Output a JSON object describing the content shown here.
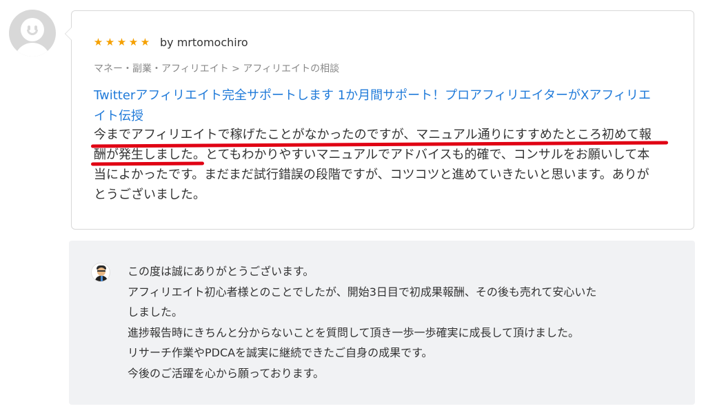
{
  "reviewer": {
    "avatar_icon": "default-user-avatar-icon",
    "stars": [
      "★",
      "★",
      "★",
      "★",
      "★"
    ],
    "rating": 5,
    "by_text": "by mrtomochiro"
  },
  "review": {
    "category": "マネー・副業・アフィリエイト > アフィリエイトの相談",
    "service_title": "Twitterアフィリエイト完全サポートします 1か月間サポート！プロアフィリエイターがXアフィリエ\nイト伝授",
    "body": "今までアフィリエイトで稼げたことがなかったのですが、マニュアル通りにすすめたところ初めて報\n酬が発生しました。とてもわかりやすいマニュアルでアドバイスも的確で、コンサルをお願いして本\n当によかったです。まだまだ試行錯誤の段階ですが、コツコツと進めていきたいと思います。ありが\nとうございました。",
    "highlight_color": "#e00013"
  },
  "reply": {
    "avatar_icon": "seller-profile-avatar-icon",
    "body": "この度は誠にありがとうございます。\nアフィリエイト初心者様とのことでしたが、開始3日目で初成果報酬、その後も売れて安心いた\nしました。\n進捗報告時にきちんと分からないことを質問して頂き一歩一歩確実に成長して頂けました。\nリサーチ作業やPDCAを誠実に継続できたご自身の成果です。\n今後のご活躍を心から願っております。"
  },
  "colors": {
    "link": "#1f7ad9",
    "star": "#f5a000",
    "reply_background": "#f1f2f4",
    "border": "#d8d8d8"
  }
}
